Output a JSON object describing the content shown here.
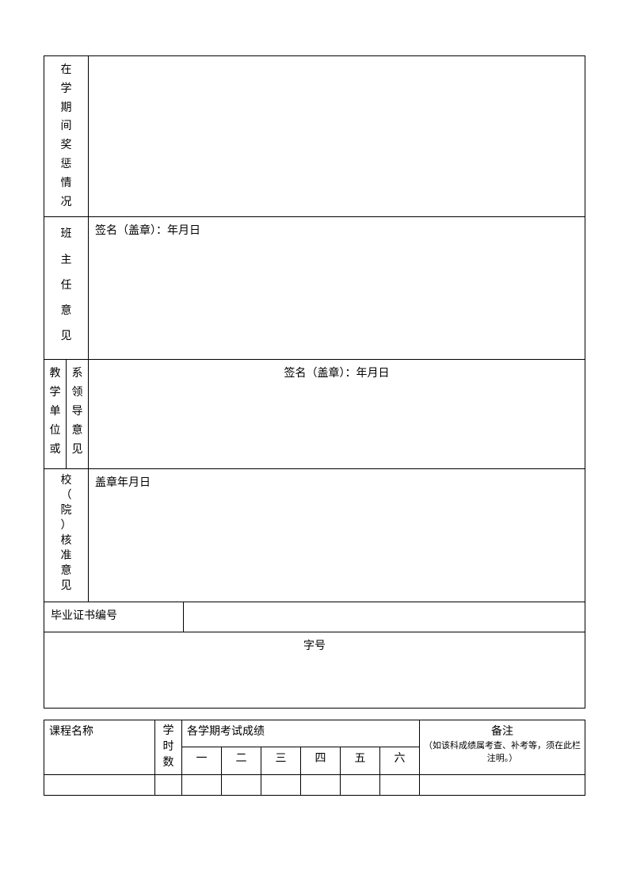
{
  "sections": {
    "rewards_punishments": {
      "label": "在学期间奖惩情况"
    },
    "class_teacher": {
      "label": "班主任意见",
      "content": "签名（盖章）：年月日"
    },
    "teaching_unit": {
      "label_left": "教学单位或",
      "label_right": "系领导意见",
      "content": "签名（盖章）：年月日"
    },
    "school_approval": {
      "label": "校（院）核准意见",
      "content": "盖章年月日"
    },
    "diploma_no": {
      "label": "毕业证书编号"
    },
    "zihao": {
      "label": "字号"
    }
  },
  "grades_table": {
    "course_name": "课程名称",
    "hours": "学时数",
    "scores_header": "各学期考试成绩",
    "terms": [
      "一",
      "二",
      "三",
      "四",
      "五",
      "六"
    ],
    "remarks": "备注",
    "remarks_note": "（如该科成绩属考查、补考等，须在此栏注明。）"
  }
}
